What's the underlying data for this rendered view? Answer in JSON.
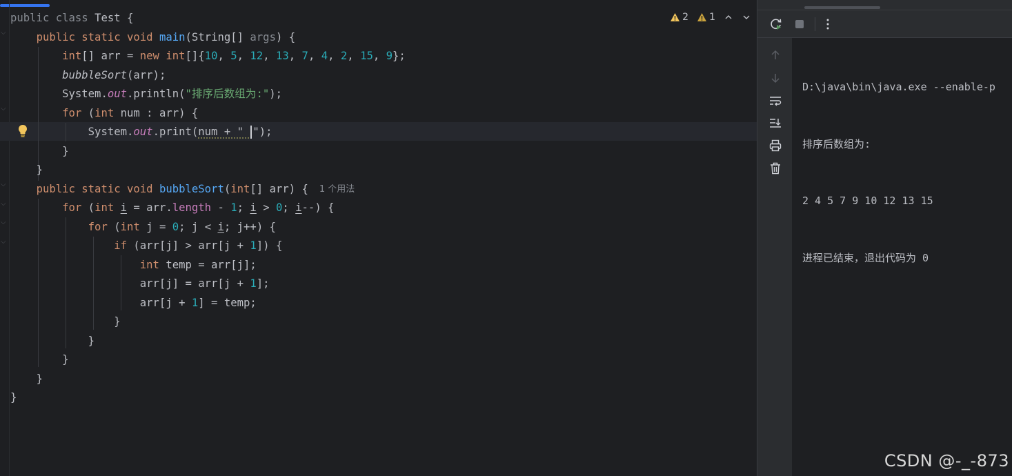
{
  "editor": {
    "inspections": {
      "warnings": "2",
      "weak_warnings": "1"
    },
    "usage_hint": "1 个用法",
    "code_lines": [
      [
        [
          "public class ",
          "t-kw0"
        ],
        [
          "Test {",
          ""
        ]
      ],
      [
        [
          "    ",
          ""
        ],
        [
          "public static void ",
          "t-kw"
        ],
        [
          "main",
          "t-fn"
        ],
        [
          "(String[] ",
          ""
        ],
        [
          "args",
          "t-dim"
        ],
        [
          ") {",
          ""
        ]
      ],
      [
        [
          "        ",
          ""
        ],
        [
          "int",
          "t-kw"
        ],
        [
          "[] arr = ",
          ""
        ],
        [
          "new ",
          "t-kw"
        ],
        [
          "int",
          "t-kw"
        ],
        [
          "[]{",
          ""
        ],
        [
          "10",
          "t-num"
        ],
        [
          ", ",
          ""
        ],
        [
          "5",
          "t-num"
        ],
        [
          ", ",
          ""
        ],
        [
          "12",
          "t-num"
        ],
        [
          ", ",
          ""
        ],
        [
          "13",
          "t-num"
        ],
        [
          ", ",
          ""
        ],
        [
          "7",
          "t-num"
        ],
        [
          ", ",
          ""
        ],
        [
          "4",
          "t-num"
        ],
        [
          ", ",
          ""
        ],
        [
          "2",
          "t-num"
        ],
        [
          ", ",
          ""
        ],
        [
          "15",
          "t-num"
        ],
        [
          ", ",
          ""
        ],
        [
          "9",
          "t-num"
        ],
        [
          "};",
          ""
        ]
      ],
      [
        [
          "        ",
          ""
        ],
        [
          "bubbleSort",
          "t-it"
        ],
        [
          "(arr);",
          ""
        ]
      ],
      [
        [
          "        ",
          ""
        ],
        [
          "System.",
          ""
        ],
        [
          "out",
          "t-fld"
        ],
        [
          ".println(",
          ""
        ],
        [
          "\"排序后数组为:\"",
          "t-str"
        ],
        [
          ");",
          ""
        ]
      ],
      [
        [
          "        ",
          ""
        ],
        [
          "for ",
          "t-kw"
        ],
        [
          "(",
          ""
        ],
        [
          "int ",
          "t-kw"
        ],
        [
          "num : arr) {",
          ""
        ]
      ],
      [
        [
          "            ",
          ""
        ],
        [
          "System.",
          ""
        ],
        [
          "out",
          "t-fld"
        ],
        [
          ".print(",
          ""
        ],
        [
          "num + \" ",
          "t-wav"
        ],
        [
          "CARET",
          ""
        ],
        [
          "\");",
          ""
        ]
      ],
      [
        [
          "        ",
          ""
        ],
        [
          "}",
          ""
        ]
      ],
      [
        [
          "    ",
          ""
        ],
        [
          "}",
          ""
        ]
      ],
      [
        [
          "    ",
          ""
        ],
        [
          "public static void ",
          "t-kw"
        ],
        [
          "bubbleSort",
          "t-fn"
        ],
        [
          "(",
          ""
        ],
        [
          "int",
          "t-kw"
        ],
        [
          "[] arr) {",
          ""
        ],
        [
          "HINT",
          ""
        ]
      ],
      [
        [
          "        ",
          ""
        ],
        [
          "for ",
          "t-kw"
        ],
        [
          "(",
          ""
        ],
        [
          "int ",
          "t-kw"
        ],
        [
          "i",
          "t-ul"
        ],
        [
          " = arr.",
          ""
        ],
        [
          "length",
          "t-prop"
        ],
        [
          " - ",
          ""
        ],
        [
          "1",
          "t-num"
        ],
        [
          "; ",
          ""
        ],
        [
          "i",
          "t-ul"
        ],
        [
          " > ",
          ""
        ],
        [
          "0",
          "t-num"
        ],
        [
          "; ",
          ""
        ],
        [
          "i",
          "t-ul"
        ],
        [
          "--) {",
          ""
        ]
      ],
      [
        [
          "            ",
          ""
        ],
        [
          "for ",
          "t-kw"
        ],
        [
          "(",
          ""
        ],
        [
          "int ",
          "t-kw"
        ],
        [
          "j = ",
          ""
        ],
        [
          "0",
          "t-num"
        ],
        [
          "; j < ",
          ""
        ],
        [
          "i",
          "t-ul"
        ],
        [
          "; j++) {",
          ""
        ]
      ],
      [
        [
          "                ",
          ""
        ],
        [
          "if ",
          "t-kw"
        ],
        [
          "(arr[j] > arr[j + ",
          ""
        ],
        [
          "1",
          "t-num"
        ],
        [
          "]) {",
          ""
        ]
      ],
      [
        [
          "                    ",
          ""
        ],
        [
          "int ",
          "t-kw"
        ],
        [
          "temp = arr[j];",
          ""
        ]
      ],
      [
        [
          "                    ",
          ""
        ],
        [
          "arr[j] = arr[j + ",
          ""
        ],
        [
          "1",
          "t-num"
        ],
        [
          "];",
          ""
        ]
      ],
      [
        [
          "                    ",
          ""
        ],
        [
          "arr[j + ",
          ""
        ],
        [
          "1",
          "t-num"
        ],
        [
          "] = temp;",
          ""
        ]
      ],
      [
        [
          "                ",
          ""
        ],
        [
          "}",
          ""
        ]
      ],
      [
        [
          "            ",
          ""
        ],
        [
          "}",
          ""
        ]
      ],
      [
        [
          "        ",
          ""
        ],
        [
          "}",
          ""
        ]
      ],
      [
        [
          "    ",
          ""
        ],
        [
          "}",
          ""
        ]
      ],
      [
        [
          "}",
          ""
        ]
      ]
    ]
  },
  "console": {
    "lines": [
      "D:\\java\\bin\\java.exe --enable-p",
      "排序后数组为:",
      "2 4 5 7 9 10 12 13 15",
      "进程已结束，退出代码为 0"
    ]
  },
  "icons": {
    "rerun": "rerun-icon",
    "stop": "stop-icon",
    "more": "more-vertical-icon",
    "up": "arrow-up-icon",
    "down": "arrow-down-icon",
    "wrap": "soft-wrap-icon",
    "scroll": "scroll-to-end-icon",
    "print": "print-icon",
    "trash": "trash-icon",
    "bulb": "lightbulb-icon"
  },
  "colors": {
    "keyword": "#cf8e6d",
    "function": "#56a8f5",
    "number": "#2aacb8",
    "string": "#6aab73",
    "field": "#c77dbb",
    "warning": "#f2c55c",
    "accent": "#3574f0"
  },
  "watermark": "CSDN @-_-873"
}
